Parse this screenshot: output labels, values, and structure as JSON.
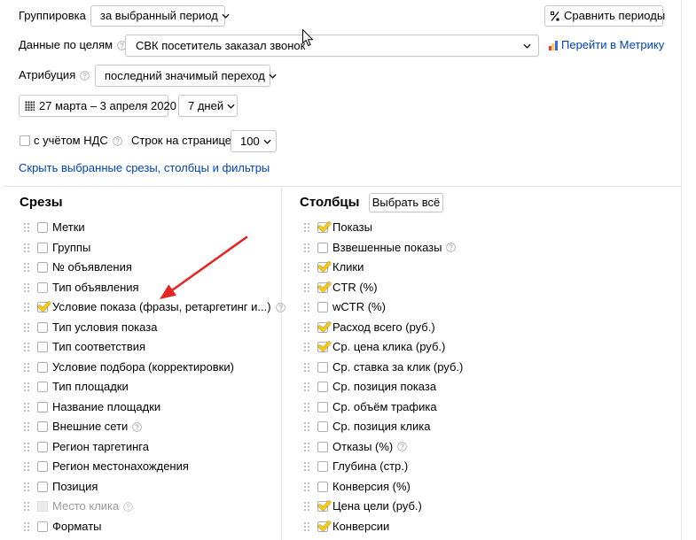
{
  "colors": {
    "text": "#000000",
    "link": "#0044bb",
    "muted": "#999999",
    "checkmark": "#ffcc00",
    "divider": "#e6e6e6",
    "annotation_arrow": "#e52521"
  },
  "icons": {
    "compare": "compare-icon",
    "metrika": "metrika-icon",
    "calendar": "calendar-icon",
    "dropdown": "chevron-down-icon",
    "help": "help-icon",
    "drag": "drag-handle-icon",
    "cursor": "mouse-cursor-icon"
  },
  "settings": {
    "grouping": {
      "label": "Группировка",
      "value": "за выбранный период"
    },
    "compare_button": {
      "label": "Сравнить периоды"
    },
    "goals": {
      "label": "Данные по целям",
      "value": "СВК посетитель заказал звонок"
    },
    "metrika_link": {
      "label": "Перейти в Метрику"
    },
    "attribution": {
      "label": "Атрибуция",
      "value": "последний значимый переход"
    },
    "date_range": {
      "value": "27 марта – 3 апреля 2020"
    },
    "period": {
      "value": "7 дней"
    },
    "vat": {
      "label": "с учётом НДС",
      "checked": false
    },
    "rows_per_page": {
      "label": "Строк на странице",
      "value": "100"
    },
    "hide_link": {
      "label": "Скрыть выбранные срезы, столбцы и фильтры"
    }
  },
  "slices": {
    "title": "Срезы",
    "items": [
      {
        "label": "Метки",
        "checked": false
      },
      {
        "label": "Группы",
        "checked": false
      },
      {
        "label": "№ объявления",
        "checked": false
      },
      {
        "label": "Тип объявления",
        "checked": false
      },
      {
        "label": "Условие показа (фразы, ретаргетинг и...)",
        "checked": true,
        "help": true
      },
      {
        "label": "Тип условия показа",
        "checked": false
      },
      {
        "label": "Тип соответствия",
        "checked": false
      },
      {
        "label": "Условие подбора (корректировки)",
        "checked": false
      },
      {
        "label": "Тип площадки",
        "checked": false
      },
      {
        "label": "Название площадки",
        "checked": false
      },
      {
        "label": "Внешние сети",
        "checked": false,
        "help": true
      },
      {
        "label": "Регион таргетинга",
        "checked": false
      },
      {
        "label": "Регион местонахождения",
        "checked": false
      },
      {
        "label": "Позиция",
        "checked": false
      },
      {
        "label": "Место клика",
        "checked": false,
        "help": true,
        "disabled": true
      },
      {
        "label": "Форматы",
        "checked": false
      }
    ]
  },
  "columns": {
    "title": "Столбцы",
    "select_all_label": "Выбрать всё",
    "items": [
      {
        "label": "Показы",
        "checked": true
      },
      {
        "label": "Взвешенные показы",
        "checked": false,
        "help": true
      },
      {
        "label": "Клики",
        "checked": true
      },
      {
        "label": "CTR (%)",
        "checked": true
      },
      {
        "label": "wCTR (%)",
        "checked": false
      },
      {
        "label": "Расход всего (руб.)",
        "checked": true
      },
      {
        "label": "Ср. цена клика (руб.)",
        "checked": true
      },
      {
        "label": "Ср. ставка за клик (руб.)",
        "checked": false
      },
      {
        "label": "Ср. позиция показа",
        "checked": false
      },
      {
        "label": "Ср. объём трафика",
        "checked": false
      },
      {
        "label": "Ср. позиция клика",
        "checked": false
      },
      {
        "label": "Отказы (%)",
        "checked": false,
        "help": true
      },
      {
        "label": "Глубина (стр.)",
        "checked": false
      },
      {
        "label": "Конверсия (%)",
        "checked": false
      },
      {
        "label": "Цена цели (руб.)",
        "checked": true
      },
      {
        "label": "Конверсии",
        "checked": true
      }
    ]
  }
}
